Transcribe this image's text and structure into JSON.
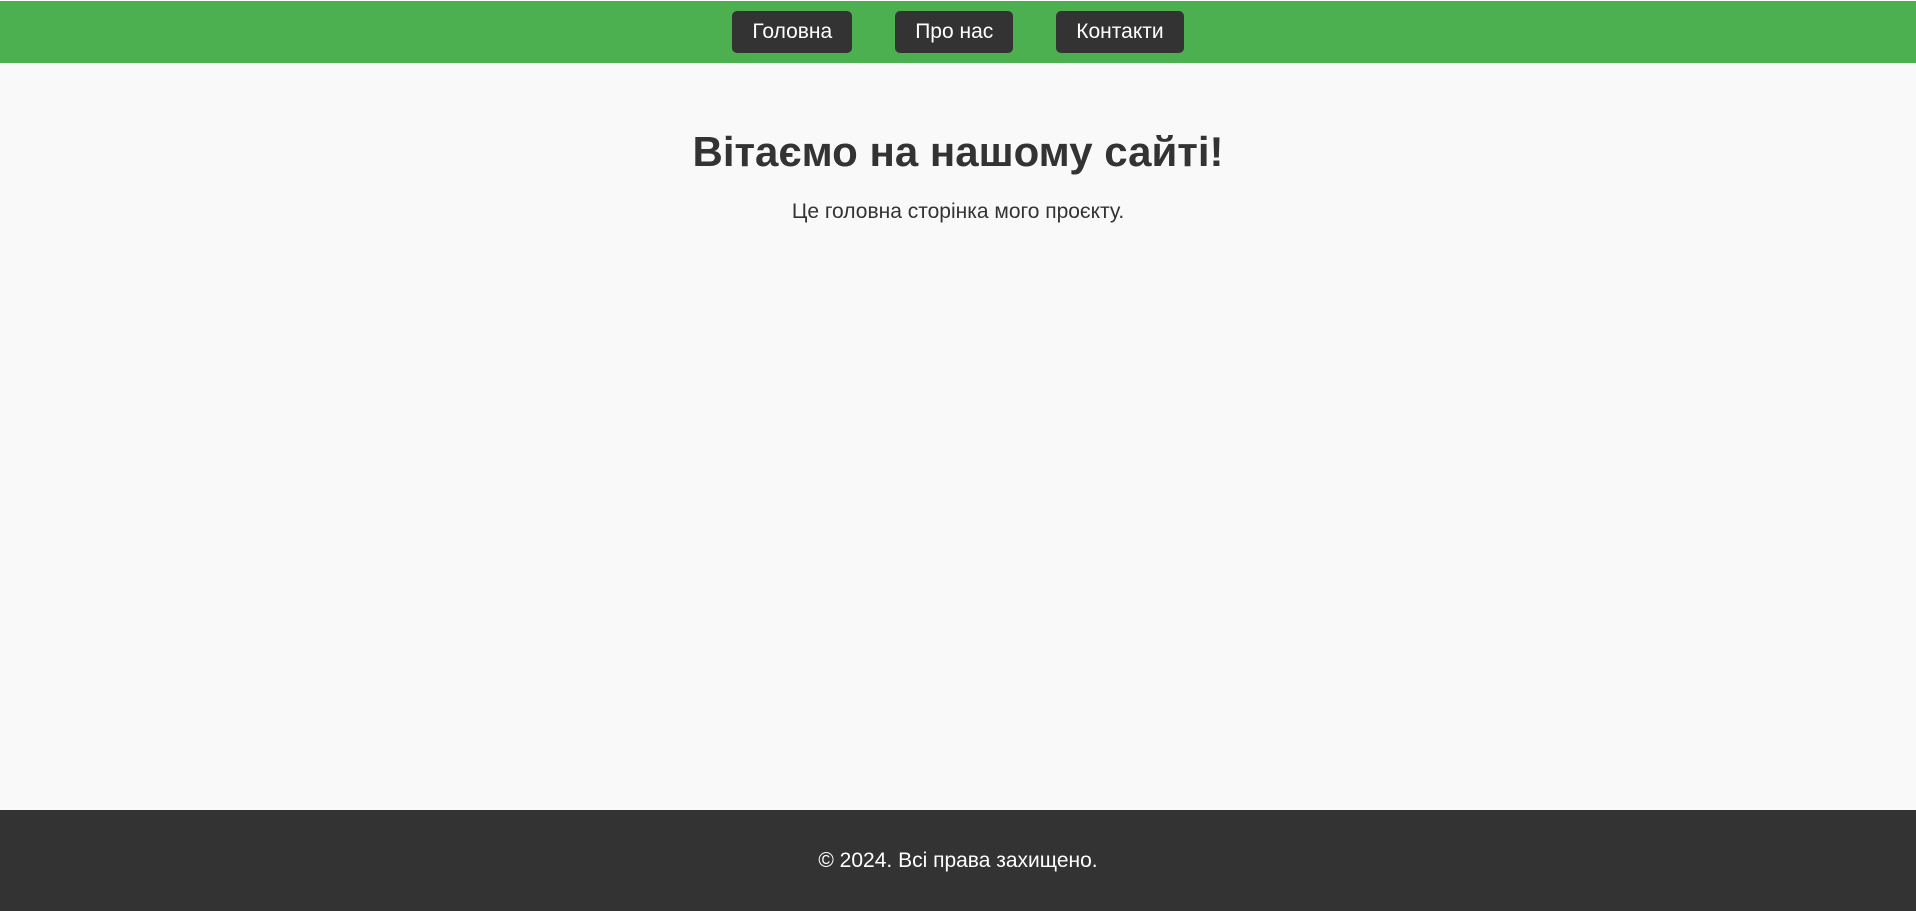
{
  "nav": {
    "items": [
      {
        "label": "Головна"
      },
      {
        "label": "Про нас"
      },
      {
        "label": "Контакти"
      }
    ]
  },
  "main": {
    "title": "Вітаємо на нашому сайті!",
    "subtitle": "Це головна сторінка мого проєкту."
  },
  "footer": {
    "text": "© 2024. Всі права захищено."
  },
  "colors": {
    "nav_background": "#4caf50",
    "button_background": "#333333",
    "page_background": "#f9f9f9",
    "footer_background": "#333333"
  }
}
